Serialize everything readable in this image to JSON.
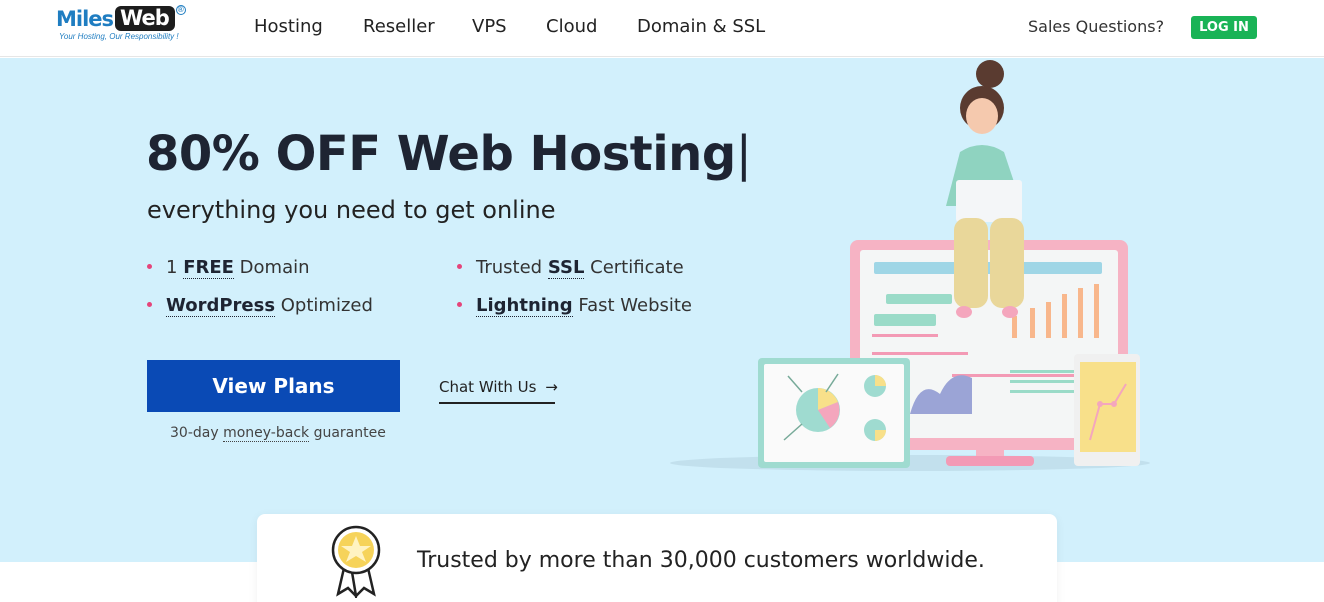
{
  "brand": {
    "part1": "Miles",
    "part2": "Web",
    "registered": "®",
    "tagline": "Your Hosting, Our Responsibility !"
  },
  "nav": {
    "items": [
      {
        "label": "Hosting"
      },
      {
        "label": "Reseller"
      },
      {
        "label": "VPS"
      },
      {
        "label": "Cloud"
      },
      {
        "label": "Domain & SSL"
      }
    ],
    "sales": "Sales Questions?",
    "login": "LOG IN"
  },
  "hero": {
    "title": "80% OFF Web Hosting",
    "cursor": "|",
    "subtitle": "everything you need to get online",
    "features": [
      {
        "pre": "1 ",
        "bold": "FREE",
        "post": " Domain"
      },
      {
        "pre": "Trusted ",
        "bold": "SSL",
        "post": " Certificate"
      },
      {
        "pre": "",
        "bold": "WordPress",
        "post": " Optimized"
      },
      {
        "pre": "",
        "bold": "Lightning",
        "post": " Fast Website"
      }
    ],
    "cta": "View Plans",
    "chat": "Chat With Us",
    "chat_arrow": "→",
    "guarantee_pre": "30-day ",
    "guarantee_link": "money-back",
    "guarantee_post": " guarantee"
  },
  "trust": {
    "text": "Trusted by more than 30,000 customers worldwide."
  },
  "colors": {
    "accent_blue": "#0a4ab5",
    "login_green": "#19b356",
    "hero_bg": "#d2f0fc",
    "bullet_pink": "#e5447a"
  }
}
